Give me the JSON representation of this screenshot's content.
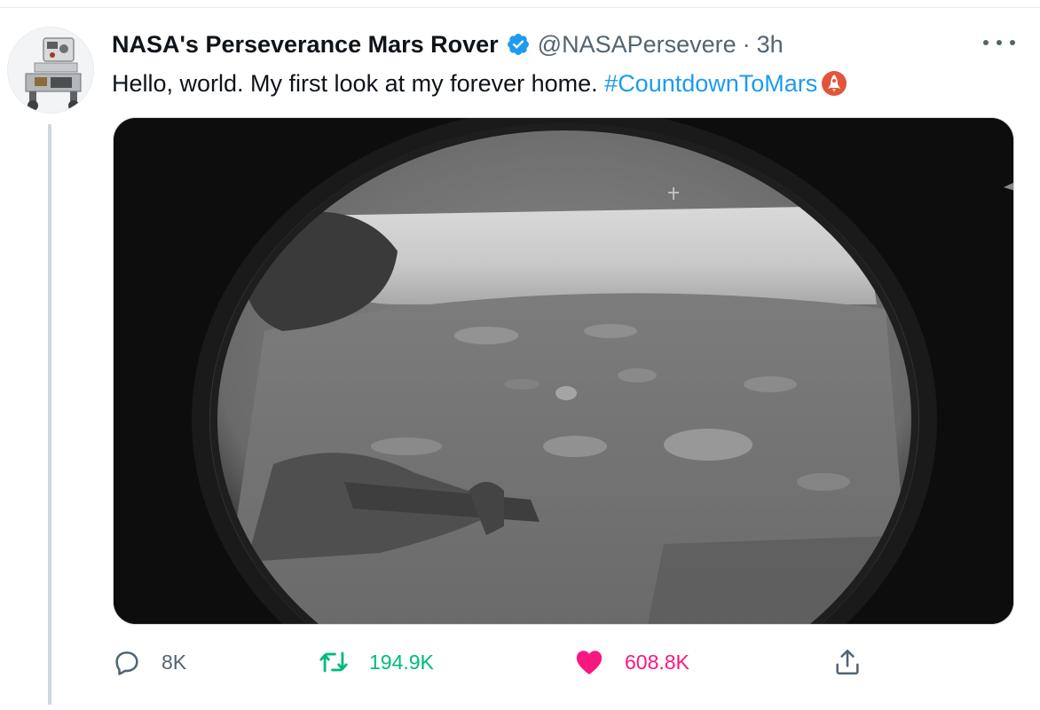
{
  "tweet": {
    "display_name": "NASA's Perseverance Mars Rover",
    "handle": "@NASAPersevere",
    "separator": "·",
    "timestamp": "3h",
    "text_main": "Hello, world. My first look at my forever home. ",
    "hashtag": "#CountdownToMars",
    "verified": true
  },
  "actions": {
    "reply_count": "8K",
    "retweet_count": "194.9K",
    "like_count": "608.8K"
  },
  "icons": {
    "more": "more-horizontal-icon",
    "verified": "verified-badge-icon",
    "reply": "reply-icon",
    "retweet": "retweet-icon",
    "like": "heart-icon",
    "share": "share-icon",
    "emoji": "rocket-emoji"
  },
  "colors": {
    "accent_blue": "#1d9bf0",
    "retweet_green": "#00ba7c",
    "like_pink": "#f91880",
    "secondary_text": "#536471"
  }
}
